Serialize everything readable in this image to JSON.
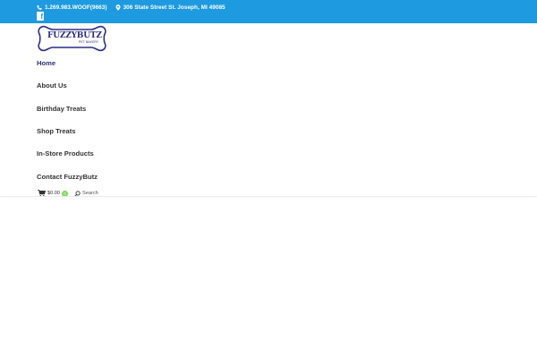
{
  "topbar": {
    "phone": "1.269.983.WOOF(9663)",
    "address": "306 State Street St. Joseph, MI 49085",
    "social_icon": "facebook-icon",
    "social_glyph": "f",
    "color": "#1e9be0"
  },
  "logo": {
    "name": "FUZZYBUTZ",
    "tagline": "PET BAKERY"
  },
  "nav": {
    "items": [
      {
        "label": "Home",
        "active": true
      },
      {
        "label": "About Us"
      },
      {
        "label": "Birthday Treats"
      },
      {
        "label": "Shop Treats"
      },
      {
        "label": "In-Store Products"
      },
      {
        "label": "Contact FuzzyButz"
      }
    ],
    "active_color": "#2b2f86"
  },
  "cart": {
    "amount": "$0.00",
    "count": "0",
    "icon": "cart-icon",
    "badge_color": "#7ed957"
  },
  "search": {
    "label": "Search",
    "icon": "search-icon"
  }
}
